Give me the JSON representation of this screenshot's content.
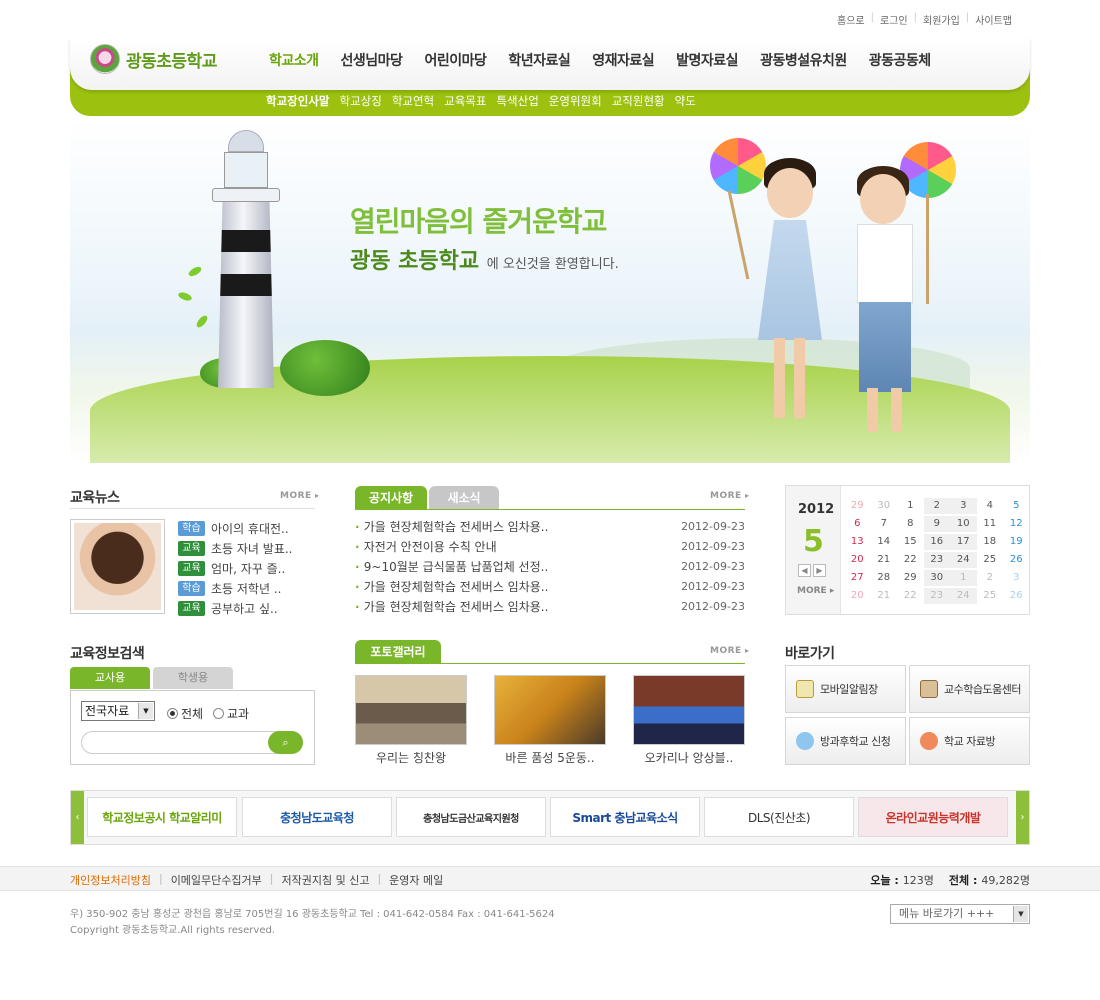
{
  "util": {
    "home": "홈으로",
    "login": "로그인",
    "join": "회원가입",
    "sitemap": "사이트맵"
  },
  "logo": {
    "name": "광동초등학교"
  },
  "nav": [
    "학교소개",
    "선생님마당",
    "어린이마당",
    "학년자료실",
    "영재자료실",
    "발명자료실",
    "광동병설유치원",
    "광동공동체"
  ],
  "subnav": [
    "학교장인사말",
    "학교상징",
    "학교연혁",
    "교육목표",
    "특색산업",
    "운영위원회",
    "교직원현황",
    "약도"
  ],
  "hero": {
    "line1": "열린마음의 즐거운학교",
    "line2": "광동 초등학교",
    "line2_rest": "에 오신것을 환영합니다."
  },
  "news": {
    "title": "교육뉴스",
    "more": "MORE",
    "items": [
      {
        "tag": "학습",
        "text": "아이의 휴대전..",
        "color": "#5a9bd5"
      },
      {
        "tag": "교육",
        "text": "초등 자녀 발표..",
        "color": "#2f8f3a"
      },
      {
        "tag": "교육",
        "text": "엄마, 자꾸 즐..",
        "color": "#2f8f3a"
      },
      {
        "tag": "학습",
        "text": "초등 저학년 ..",
        "color": "#5a9bd5"
      },
      {
        "tag": "교육",
        "text": "공부하고 싶..",
        "color": "#2f8f3a"
      }
    ]
  },
  "notice": {
    "tab_notice": "공지사항",
    "tab_news": "새소식",
    "more": "MORE",
    "items": [
      {
        "title": "가을 현장체험학습 전세버스 임차용..",
        "date": "2012-09-23"
      },
      {
        "title": "자전거 안전이용 수칙 안내",
        "date": "2012-09-23"
      },
      {
        "title": "9~10월분 급식물품 납품업체 선정..",
        "date": "2012-09-23"
      },
      {
        "title": "가을 현장체험학습 전세버스 임차용..",
        "date": "2012-09-23"
      },
      {
        "title": "가을 현장체험학습 전세버스 임차용..",
        "date": "2012-09-23"
      }
    ]
  },
  "calendar": {
    "year": "2012",
    "month": "5",
    "more": "MORE",
    "days": [
      [
        "29",
        "30",
        "1",
        "2",
        "3",
        "4",
        "5"
      ],
      [
        "6",
        "7",
        "8",
        "9",
        "10",
        "11",
        "12"
      ],
      [
        "13",
        "14",
        "15",
        "16",
        "17",
        "18",
        "19"
      ],
      [
        "20",
        "21",
        "22",
        "23",
        "24",
        "25",
        "26"
      ],
      [
        "27",
        "28",
        "29",
        "30",
        "1",
        "2",
        "3"
      ],
      [
        "20",
        "21",
        "22",
        "23",
        "24",
        "25",
        "26"
      ]
    ]
  },
  "search": {
    "title": "교육정보검색",
    "tab_teacher": "교사용",
    "tab_student": "학생용",
    "select_value": "전국자료",
    "radio_all": "전체",
    "radio_subject": "교과"
  },
  "gallery": {
    "title": "포토갤러리",
    "more": "MORE",
    "items": [
      "우리는 칭찬왕",
      "바른 품성 5운동..",
      "오카리나 앙상블.."
    ]
  },
  "quick": {
    "title": "바로가기",
    "items": [
      "모바일알림장",
      "교수학습도움센터",
      "방과후학교 신청",
      "학교 자료방"
    ]
  },
  "banners": [
    "학교정보공시 학교알리미",
    "충청남도교육청",
    "충청남도금산교육지원청",
    "Smart 충남교육소식",
    "DLS(진산초)",
    "온라인교원능력개발"
  ],
  "footer": {
    "links": [
      "개인정보처리방침",
      "이메일무단수집거부",
      "저작권지침 및 신고",
      "운영자 메일"
    ],
    "today_label": "오늘 :",
    "today_value": "123명",
    "total_label": "전체 :",
    "total_value": "49,282명",
    "address": "우) 350-902 충남 홍성군 광천읍 홍남로 705번길 16 광동초등학교  Tel : 041-642-0584  Fax : 041-641-5624",
    "copyright": "Copyright 광동초등학교.All rights reserved.",
    "menu_jump": "메뉴 바로가기 +++"
  },
  "colors": {
    "accent": "#7ab62a",
    "header_green": "#9cc20f",
    "sunday": "#d6284a",
    "saturday": "#2590d6"
  }
}
